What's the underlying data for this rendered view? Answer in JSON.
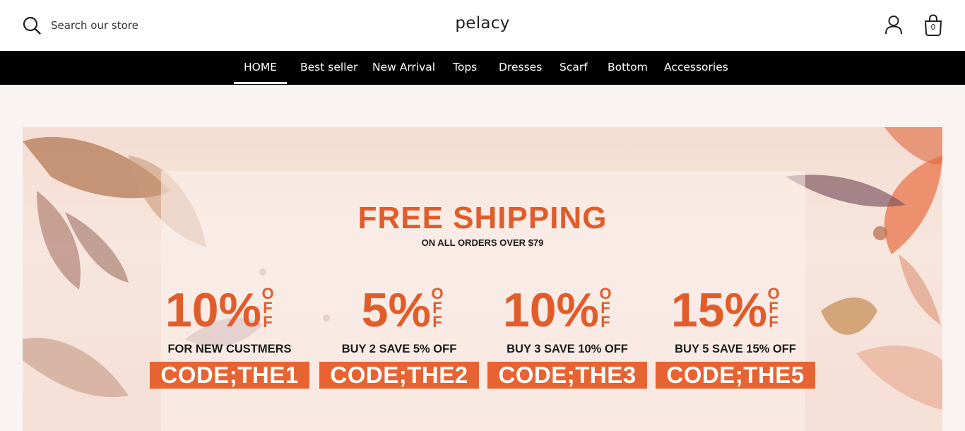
{
  "header": {
    "search_placeholder": "Search our store",
    "logo": "pelacy",
    "cart_count": "0"
  },
  "nav": {
    "items": [
      "HOME",
      "Best seller",
      "New Arrival",
      "Tops",
      "Dresses",
      "Scarf",
      "Bottom",
      "Accessories"
    ],
    "active": "HOME"
  },
  "banner": {
    "title": "FREE SHIPPING",
    "subtitle": "ON ALL ORDERS OVER $79",
    "offers": [
      {
        "percent": "10%",
        "off": "OFF",
        "description": "FOR NEW CUSTMERS",
        "code": "CODE;THE1"
      },
      {
        "percent": "5%",
        "off": "OFF",
        "description": "BUY 2 SAVE 5% OFF",
        "code": "CODE;THE2"
      },
      {
        "percent": "10%",
        "off": "OFF",
        "description": "BUY 3 SAVE 10% OFF",
        "code": "CODE;THE3"
      },
      {
        "percent": "15%",
        "off": "OFF",
        "description": "BUY 5 SAVE 15% OFF",
        "code": "CODE;THE5"
      }
    ]
  },
  "colors": {
    "accent": "#e05d2b",
    "code_bg": "#e86332",
    "nav_bg": "#000000",
    "page_bg": "#f9f3f1"
  },
  "icons": [
    "search-icon",
    "account-icon",
    "cart-icon"
  ]
}
